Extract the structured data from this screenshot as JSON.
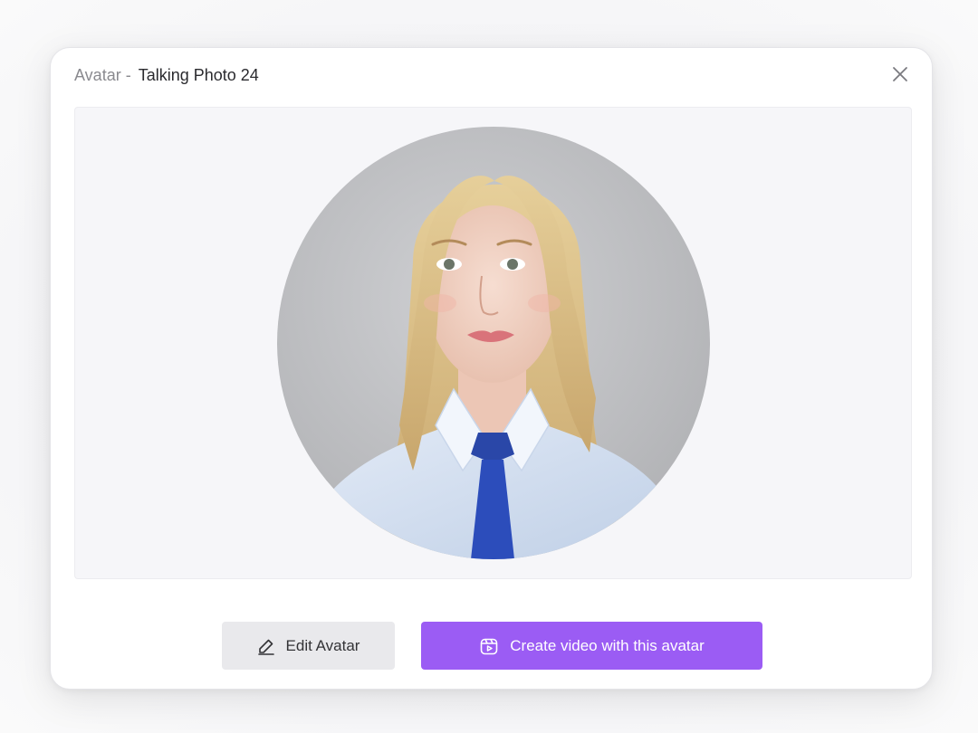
{
  "dialog": {
    "title_prefix": "Avatar -",
    "title_name": "Talking Photo 24"
  },
  "icons": {
    "close": "close-icon",
    "edit": "pencil-icon",
    "create": "video-icon"
  },
  "actions": {
    "edit_label": "Edit Avatar",
    "create_label": "Create video with this avatar"
  },
  "colors": {
    "primary": "#9b5cf4",
    "secondary_button": "#e9e9ec",
    "preview_background": "#f6f6f9"
  }
}
